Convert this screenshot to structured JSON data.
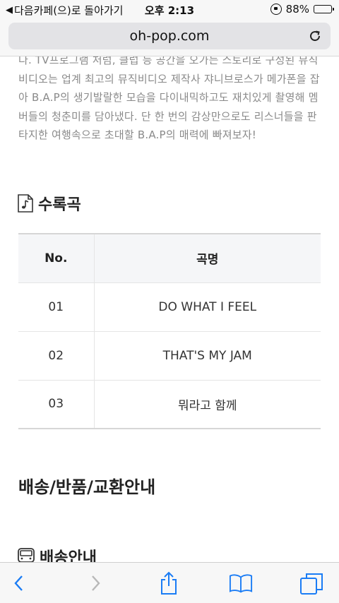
{
  "status": {
    "back_label": "다음카페(으)로 돌아가기",
    "time": "오후 2:13",
    "battery": "88%",
    "battery_level": 0.88
  },
  "browser": {
    "url": "oh-pop.com"
  },
  "article": {
    "description": "다. TV프로그램 처럼, 클럽 등 공간을 오가는 스토리로 구성된 뮤직비디오는 업계 최고의 뮤직비디오 제작사 쟈니브로스가 메가폰을 잡아 B.A.P의 생기발랄한 모습을 다이내믹하고도 재치있게 촬영해 멤버들의 청춘미를 담아냈다. 단 한 번의 감상만으로도 리스너들을 판타지한 여행속으로 초대할 B.A.P의 매력에 빠져보자!"
  },
  "tracklist": {
    "title": "수록곡",
    "headers": {
      "no": "No.",
      "title": "곡명"
    },
    "rows": [
      {
        "no": "01",
        "title": "DO WHAT I FEEL"
      },
      {
        "no": "02",
        "title": "THAT'S MY JAM"
      },
      {
        "no": "03",
        "title": "뭐라고 함께"
      }
    ]
  },
  "shipping": {
    "title": "배송/반품/교환안내",
    "sub_title": "배송안내"
  },
  "icons": {
    "accent": "#1a7cf5",
    "disabled": "#b8b8b8"
  }
}
